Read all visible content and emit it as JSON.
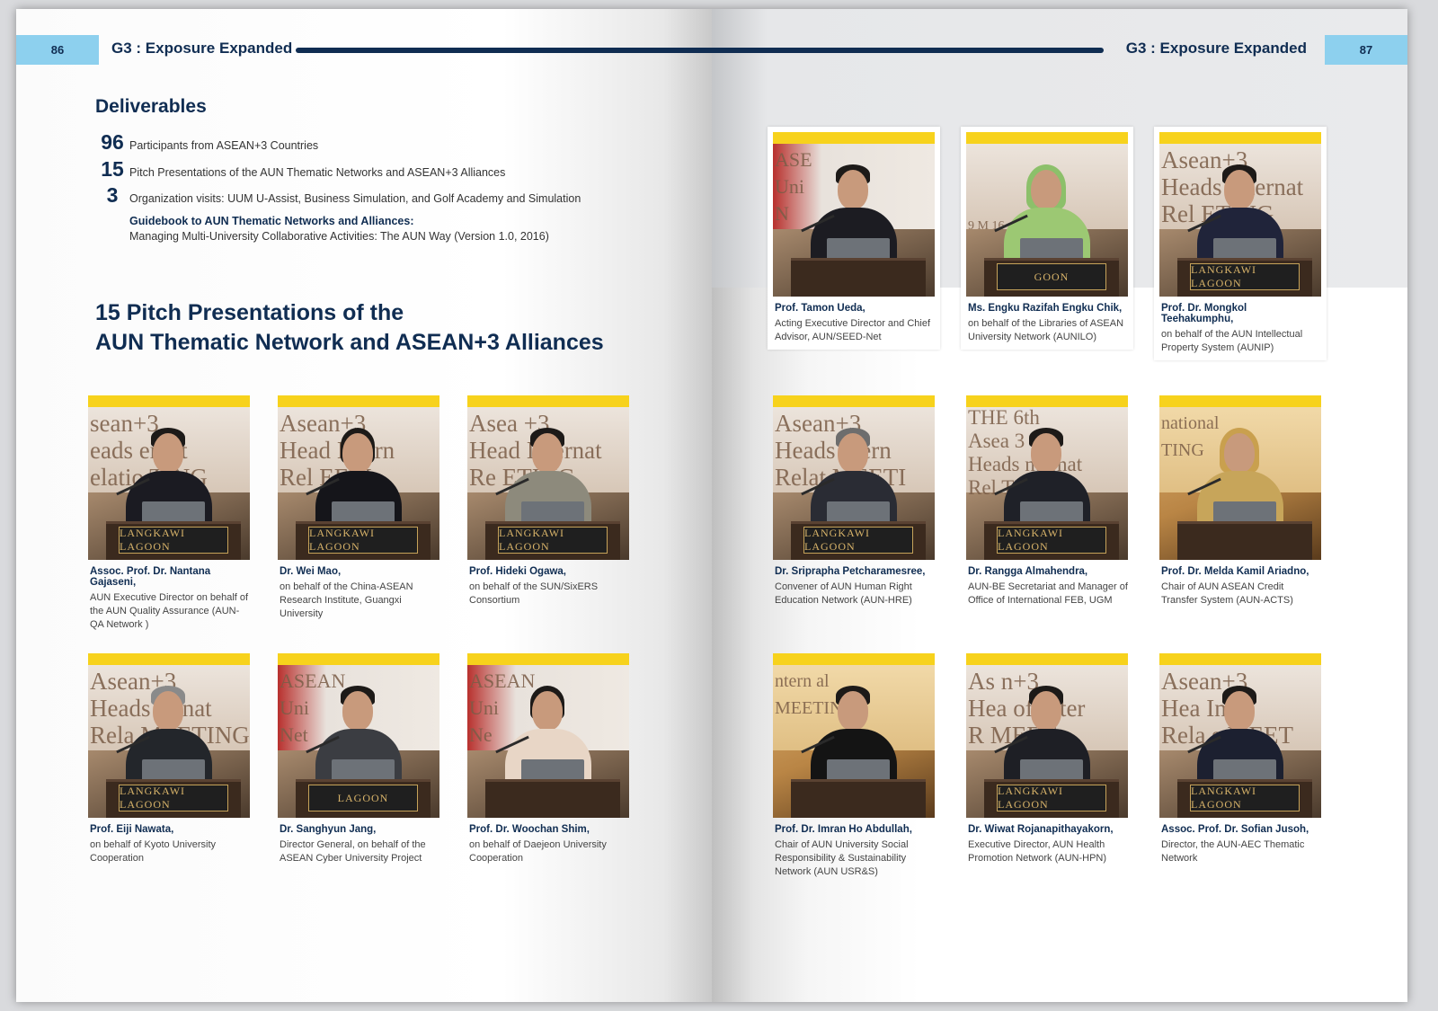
{
  "left_page": {
    "page_number": "86",
    "header_title": "G3 : Exposure Expanded",
    "deliverables": {
      "title": "Deliverables",
      "items": [
        {
          "number": "96",
          "text": "Participants from ASEAN+3 Countries"
        },
        {
          "number": "15",
          "text": "Pitch Presentations of the AUN Thematic Networks and ASEAN+3  Alliances"
        },
        {
          "number": "3",
          "text": "Organization visits: UUM U-Assist, Business Simulation, and Golf Academy and Simulation"
        }
      ],
      "guidebook_title": "Guidebook to AUN Thematic Networks and Alliances:",
      "guidebook_subtitle": "Managing Multi-University Collaborative Activities: The AUN Way (Version 1.0, 2016)"
    },
    "section_title_line1": "15 Pitch Presentations of the",
    "section_title_line2": "AUN Thematic Network and ASEAN+3 Alliances",
    "presenters": [
      {
        "name": "Assoc. Prof. Dr. Nantana Gajaseni,",
        "desc": "AUN Executive Director on behalf of the AUN Quality Assurance (AUN-QA Network )",
        "banner": "sean+3\neads ernat\nelatio TING",
        "sign": "LANGKAWI LAGOON"
      },
      {
        "name": "Dr. Wei Mao,",
        "desc": "on behalf of the China-ASEAN Research Institute, Guangxi University",
        "banner": "Asean+3\nHead Intern\nRel EETI",
        "sign": "LANGKAWI LAGOON"
      },
      {
        "name": "Prof. Hideki Ogawa,",
        "desc": "on behalf of the SUN/SixERS Consortium",
        "banner": "Asea +3\nHead Internat\nRe ETING",
        "sign": "LANGKAWI LAGOON"
      },
      {
        "name": "Prof. Eiji Nawata,",
        "desc": "on behalf of  Kyoto University Cooperation",
        "banner": "Asean+3\nHeads ternat\nRela MEETING",
        "sign": "LANGKAWI LAGOON"
      },
      {
        "name": "Dr. Sanghyun Jang,",
        "desc": "Director General, on behalf of the ASEAN Cyber University Project",
        "banner": "ASEAN\nUni\nNet",
        "sign": "LAGOON"
      },
      {
        "name": "Prof. Dr. Woochan Shim,",
        "desc": "on behalf of Daejeon University Cooperation",
        "banner": "ASEAN\nUni\nNe",
        "sign": ""
      }
    ]
  },
  "right_page": {
    "page_number": "87",
    "header_title": "G3 : Exposure Expanded",
    "presenters": [
      {
        "name": "Prof. Tamon Ueda,",
        "desc": "Acting Executive Director and Chief Advisor, AUN/SEED-Net",
        "banner": "ASE\nUni\nN",
        "sign": ""
      },
      {
        "name": "Ms. Engku Razifah Engku Chik,",
        "desc": "on behalf of the Libraries of ASEAN University Network (AUNILO)",
        "banner": "9 M 16",
        "sign": "GOON"
      },
      {
        "name": "Prof. Dr. Mongkol Teehakumphu,",
        "desc": "on behalf of the AUN Intellectual Property System (AUNIP)",
        "banner": "Asean+3\nHeads Internat\nRel ETING",
        "sign": "LANGKAWI LAGOON"
      },
      {
        "name": "Dr. Sriprapha Petcharamesree,",
        "desc": "Convener of AUN Human Right Education Network (AUN-HRE)",
        "banner": "Asean+3\nHeads ntern\nRelat MEETI",
        "sign": "LANGKAWI LAGOON"
      },
      {
        "name": "Dr. Rangga Almahendra,",
        "desc": "AUN-BE Secretariat and Manager of Office of International FEB, UGM",
        "banner": "THE 6th\nAsea 3\nHeads nternat\nRel TING",
        "sign": "LANGKAWI LAGOON"
      },
      {
        "name": "Prof. Dr. Melda Kamil Ariadno,",
        "desc": "Chair of AUN ASEAN Credit Transfer System (AUN-ACTS)",
        "banner": "national\nTING",
        "sign": ""
      },
      {
        "name": "Prof. Dr. Imran Ho Abdullah,",
        "desc": "Chair of AUN University Social Responsibility & Sustainability Network (AUN USR&S)",
        "banner": "ntern al\nMEETIN",
        "sign": ""
      },
      {
        "name": "Dr. Wiwat Rojanapithayakorn,",
        "desc": "Executive Director, AUN Health Promotion Network (AUN-HPN)",
        "banner": "As n+3\nHea of Inter\nR MEET",
        "sign": "LANGKAWI LAGOON"
      },
      {
        "name": "Assoc. Prof. Dr. Sofian Jusoh,",
        "desc": "Director, the AUN-AEC Thematic Network",
        "banner": "Asean+3\nHea Inter\nRela s MEET",
        "sign": "LANGKAWI LAGOON"
      }
    ]
  }
}
